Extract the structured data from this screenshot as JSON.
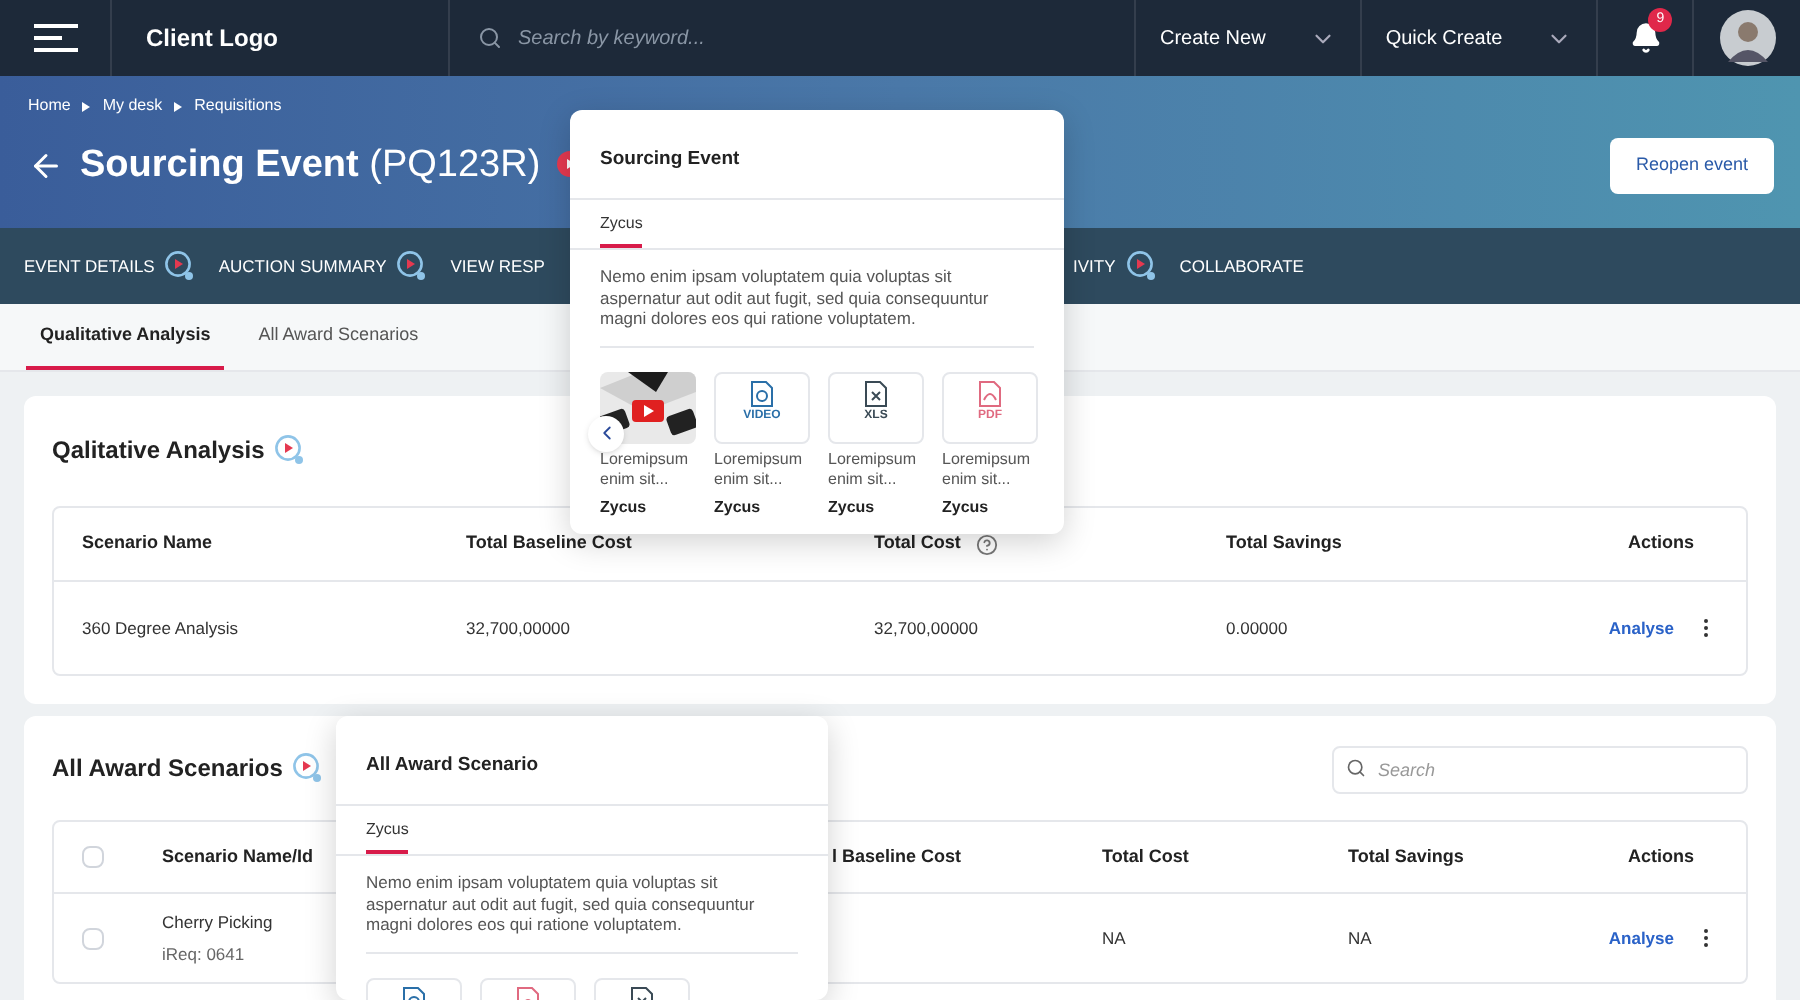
{
  "top_bar": {
    "logo": "Client Logo",
    "search_placeholder": "Search by keyword...",
    "menus": [
      "Create New",
      "Quick Create"
    ],
    "notification_count": "9"
  },
  "breadcrumb": [
    "Home",
    "My desk",
    "Requisitions"
  ],
  "title": {
    "name": "Sourcing Event",
    "code": "(PQ123R)"
  },
  "reopen_button": "Reopen event",
  "nav_tabs": [
    {
      "label": "EVENT DETAILS",
      "help": true
    },
    {
      "label": "AUCTION SUMMARY",
      "help": true
    },
    {
      "label": "VIEW RESP",
      "help": false
    },
    {
      "label": "IVITY",
      "help": true
    },
    {
      "label": "COLLABORATE",
      "help": false
    }
  ],
  "sub_tabs": [
    {
      "label": "Qualitative Analysis",
      "selected": true
    },
    {
      "label": "All Award Scenarios",
      "selected": false
    }
  ],
  "qualitative": {
    "title": "Qalitative Analysis",
    "columns": [
      "Scenario Name",
      "Total Baseline Cost",
      "Total Cost",
      "Total Savings",
      "Actions"
    ],
    "rows": [
      {
        "cells": [
          "360 Degree Analysis",
          "32,700,00000",
          "32,700,00000",
          "0.00000"
        ],
        "action": "Analyse"
      }
    ]
  },
  "awards": {
    "title": "All Award Scenarios",
    "search_placeholder": "Search",
    "all_checked": false,
    "columns": [
      "Scenario Name/Id",
      "l Baseline Cost",
      "Total Cost",
      "Total Savings",
      "Actions"
    ],
    "rows": [
      {
        "checked": false,
        "name": "Cherry Picking",
        "id": "iReq: 0641",
        "total_cost": "NA",
        "total_savings": "NA",
        "action": "Analyse"
      }
    ]
  },
  "popovers": [
    {
      "title": "Sourcing Event",
      "tab": "Zycus",
      "text": "Nemo enim ipsam voluptatem quia voluptas sit aspernatur aut odit aut fugit, sed quia consequuntur magni dolores eos qui ratione voluptatem.",
      "items": [
        {
          "kind": "picture",
          "caption": "Loremipsum enim sit...",
          "source": "Zycus"
        },
        {
          "kind": "video",
          "label": "VIDEO",
          "caption": "Loremipsum enim sit...",
          "source": "Zycus"
        },
        {
          "kind": "xls",
          "label": "XLS",
          "caption": "Loremipsum enim sit...",
          "source": "Zycus"
        },
        {
          "kind": "pdf",
          "label": "PDF",
          "caption": "Loremipsum enim sit...",
          "source": "Zycus"
        }
      ]
    },
    {
      "title": "All Award Scenario",
      "tab": "Zycus",
      "text": "Nemo enim ipsam voluptatem quia voluptas sit aspernatur aut odit aut fugit, sed quia consequuntur magni dolores eos qui ratione voluptatem.",
      "items": [
        {
          "kind": "video"
        },
        {
          "kind": "pdf"
        },
        {
          "kind": "xls"
        }
      ]
    }
  ]
}
